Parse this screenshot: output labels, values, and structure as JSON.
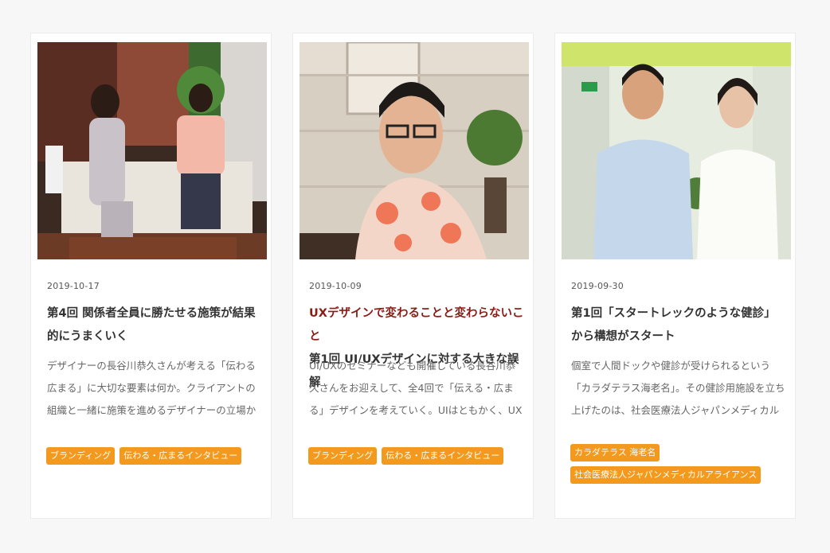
{
  "articles": [
    {
      "date": "2019-10-17",
      "title": "第4回 関係者全員に勝たせる施策が結果的にうまくいく",
      "subtitle": "",
      "excerpt": "デザイナーの長谷川恭久さんが考える「伝わる広まる」に大切な要素は何か。クライアントの組織と一緒に施策を進めるデザイナーの立場からすると、自",
      "tags": [
        "ブランディング",
        "伝わる・広まるインタビュー"
      ],
      "photo_icon": "interview-photo-icon"
    },
    {
      "date": "2019-10-09",
      "title": "第1回 UI/UXデザインに対する大きな誤解",
      "subtitle": "UXデザインで変わることと変わらないこと",
      "excerpt": "UI/UXのセミナーなども開催している長谷川恭久さんをお迎えして、全4回で「伝える・広まる」デザインを考えていく。UIはともかく、UXは、ぼんやり",
      "tags": [
        "ブランディング",
        "伝わる・広まるインタビュー"
      ],
      "photo_icon": "portrait-photo-icon"
    },
    {
      "date": "2019-09-30",
      "title": "第1回「スタートレックのような健診」から構想がスタート",
      "subtitle": "",
      "excerpt": "個室で人間ドックや健診が受けられるという「カラダテラス海老名」。その健診用施設を立ち上げたのは、社会医療法人ジャパンメディカルアライアンス",
      "tags": [
        "カラダテラス 海老名",
        "社会医療法人ジャパンメディカルアライアンス"
      ],
      "photo_icon": "duo-photo-icon"
    }
  ],
  "colors": {
    "tag_bg": "#f39a1e",
    "subtitle": "#8a1c14"
  }
}
